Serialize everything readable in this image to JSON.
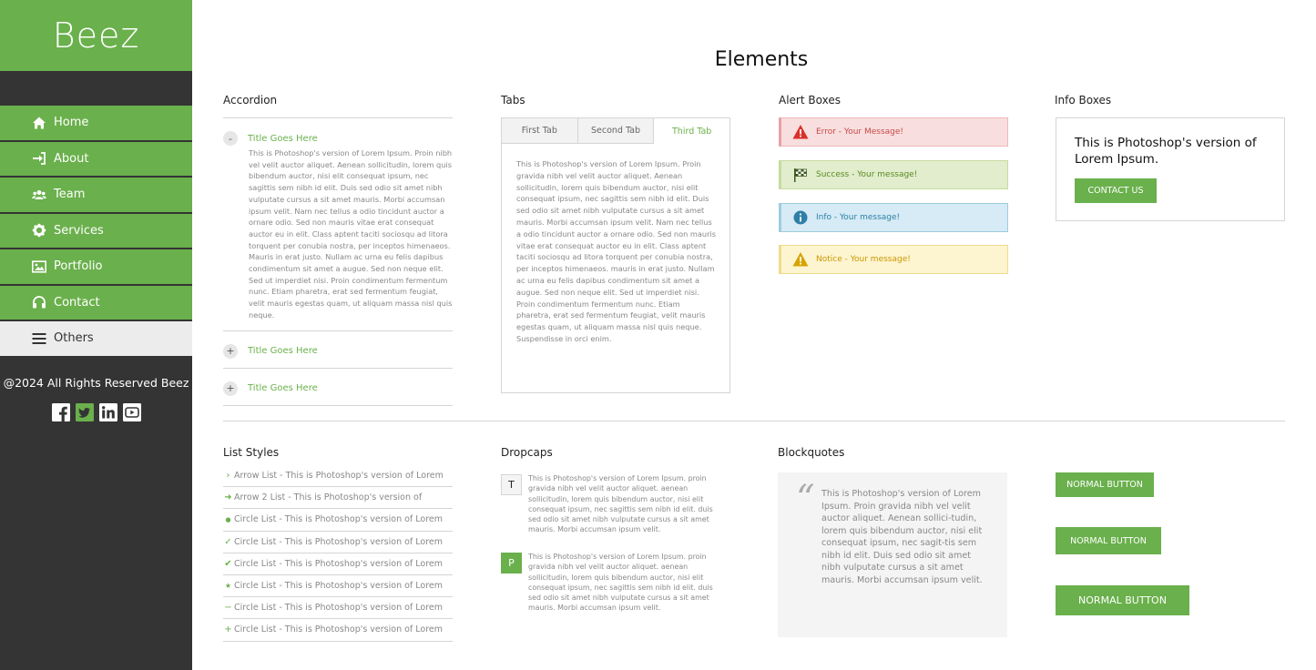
{
  "brand": {
    "logo": "Beez",
    "accent": "#6ab04c"
  },
  "sidebar": {
    "items": [
      {
        "label": "Home",
        "icon": "home-icon"
      },
      {
        "label": "About",
        "icon": "sign-in-icon"
      },
      {
        "label": "Team",
        "icon": "users-icon"
      },
      {
        "label": "Services",
        "icon": "gear-icon"
      },
      {
        "label": "Portfolio",
        "icon": "image-icon"
      },
      {
        "label": "Contact",
        "icon": "headphones-icon"
      },
      {
        "label": "Others",
        "icon": "menu-icon"
      }
    ],
    "footer": "@2024 All Rights Reserved Beez",
    "socials": [
      "facebook-icon",
      "twitter-icon",
      "linkedin-icon",
      "youtube-icon"
    ]
  },
  "main": {
    "title": "Elements",
    "accordion": {
      "heading": "Accordion",
      "items": [
        {
          "toggle": "-",
          "title": "Title Goes Here",
          "body": "This is Photoshop's version  of Lorem Ipsum. Proin nibh vel velit auctor aliquet. Aenean sollicitudin, lorem quis bibendum auctor, nisi elit consequat ipsum, nec sagittis sem nibh id elit. Duis sed odio sit amet nibh vulputate cursus a sit amet mauris. Morbi accumsan ipsum velit. Nam nec tellus a odio tincidunt auctor a ornare odio. Sed non  mauris vitae erat consequat auctor eu in elit. Class aptent taciti sociosqu ad litora torquent per conubia nostra, per inceptos himenaeos. Mauris in erat justo. Nullam ac urna eu felis dapibus condimentum sit amet a augue. Sed non neque elit. Sed ut imperdiet nisi. Proin condimentum fermentum nunc. Etiam pharetra, erat sed fermentum feugiat, velit mauris egestas quam, ut aliquam massa nisl quis neque."
        },
        {
          "toggle": "+",
          "title": "Title Goes Here"
        },
        {
          "toggle": "+",
          "title": "Title Goes Here"
        }
      ]
    },
    "tabs": {
      "heading": "Tabs",
      "labels": [
        "First Tab",
        "Second Tab",
        "Third Tab"
      ],
      "active": "Third Tab",
      "body": "This is Photoshop's version  of Lorem Ipsum. Proin gravida nibh vel velit auctor aliquet. Aenean sollicitudin, lorem quis bibendum auctor, nisi elit consequat ipsum, nec sagittis sem nibh id elit. Duis sed odio sit amet nibh vulputate cursus a sit amet mauris. Morbi accumsan ipsum velit. Nam nec tellus a odio tincidunt auctor a ornare odio. Sed non  mauris vitae erat consequat auctor eu in elit. Class aptent taciti sociosqu ad litora torquent per conubia nostra, per inceptos himenaeos. mauris in erat justo. Nullam ac urna eu felis dapibus condimentum sit amet a augue. Sed non neque elit. Sed ut imperdiet nisi. Proin condimentum fermentum nunc. Etiam pharetra, erat sed fermentum feugiat, velit mauris egestas quam, ut aliquam massa nisl quis neque. Suspendisse in orci enim."
    },
    "alerts": {
      "heading": "Alert Boxes",
      "error": "Error - Your Message!",
      "success": "Success - Your message!",
      "info": "Info - Your message!",
      "notice": "Notice - Your message!"
    },
    "info_box": {
      "heading": "Info Boxes",
      "text": "This is Photoshop's version  of Lorem Ipsum.",
      "button": "CONTACT US"
    },
    "lists": {
      "heading": "List Styles",
      "items": [
        {
          "icon": "›",
          "text": "Arrow List - This is Photoshop's version  of Lorem"
        },
        {
          "icon": "➜",
          "text": "Arrow 2 List  - This is Photoshop's version  of"
        },
        {
          "icon": "●",
          "text": "Circle List  - This is Photoshop's version  of Lorem"
        },
        {
          "icon": "✓",
          "text": "Circle List  - This is Photoshop's version  of Lorem"
        },
        {
          "icon": "✔",
          "text": "Circle List  - This is Photoshop's version  of Lorem"
        },
        {
          "icon": "★",
          "text": "Circle List  - This is Photoshop's version  of Lorem"
        },
        {
          "icon": "−",
          "text": "Circle List  - This is Photoshop's version  of Lorem"
        },
        {
          "icon": "+",
          "text": "Circle List  - This is Photoshop's version  of Lorem"
        }
      ]
    },
    "dropcaps": {
      "heading": "Dropcaps",
      "items": [
        {
          "letter": "T",
          "text": "This is Photoshop's version  of Lorem Ipsum. proin gravida nibh vel velit auctor aliquet. aenean sollicitudin, lorem quis bibendum auctor, nisi elit consequat ipsum, nec sagittis sem nibh id elit. duis sed odio sit amet nibh vulputate cursus a sit amet mauris. Morbi accumsan ipsum velit."
        },
        {
          "letter": "P",
          "text": "This is Photoshop's version  of Lorem Ipsum. proin gravida nibh vel velit auctor aliquet. aenean sollicitudin, lorem quis bibendum auctor, nisi elit consequat ipsum, nec sagittis sem nibh id elit. duis sed odio sit amet nibh vulputate cursus a sit amet mauris. Morbi accumsan ipsum velit."
        }
      ]
    },
    "blockquote": {
      "heading": "Blockquotes",
      "mark": "“",
      "text": "This is Photoshop's version  of Lorem Ipsum. Proin gravida nibh vel velit auctor aliquet. Aenean sollici-tudin, lorem quis bibendum auctor, nisi elit consequat ipsum, nec sagit-tis sem nibh id elit. Duis sed odio sit amet nibh vulputate cursus a sit amet mauris. Morbi accumsan ipsum velit."
    },
    "buttons": [
      "NORMAL BUTTON",
      "NORMAL BUTTON",
      "NORMAL BUTTON"
    ]
  }
}
